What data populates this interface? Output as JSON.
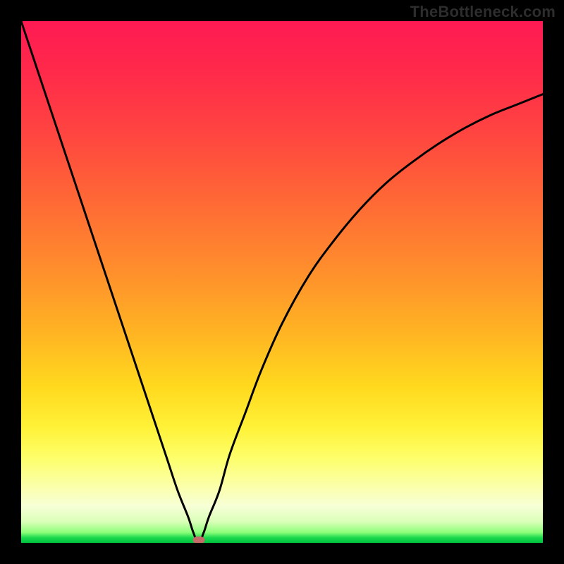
{
  "watermark": "TheBottleneck.com",
  "chart_data": {
    "type": "line",
    "title": "",
    "xlabel": "",
    "ylabel": "",
    "xlim": [
      0,
      100
    ],
    "ylim": [
      0,
      100
    ],
    "grid": false,
    "legend": false,
    "background_gradient": {
      "direction": "vertical",
      "stops": [
        {
          "pos": 0,
          "color": "#ff1a53"
        },
        {
          "pos": 35,
          "color": "#ff6a35"
        },
        {
          "pos": 70,
          "color": "#ffd91e"
        },
        {
          "pos": 93,
          "color": "#f7ffd6"
        },
        {
          "pos": 100,
          "color": "#00c23f"
        }
      ]
    },
    "series": [
      {
        "name": "bottleneck-curve",
        "color": "#000000",
        "x": [
          0,
          2,
          4,
          6,
          8,
          10,
          12,
          14,
          16,
          18,
          20,
          22,
          24,
          26,
          28,
          30,
          32,
          33,
          34,
          35,
          36,
          38,
          40,
          43,
          46,
          50,
          55,
          60,
          65,
          70,
          75,
          80,
          85,
          90,
          95,
          100
        ],
        "y": [
          100,
          94,
          88,
          82,
          76,
          70,
          64,
          58,
          52,
          46,
          40,
          34,
          28,
          22,
          16,
          10,
          5,
          2,
          0,
          2,
          5,
          10,
          17,
          25,
          33,
          42,
          51,
          58,
          64,
          69,
          73,
          76.5,
          79.5,
          82,
          84,
          86
        ]
      }
    ],
    "min_point": {
      "x": 34,
      "y": 0,
      "color": "#c66a6a"
    }
  }
}
